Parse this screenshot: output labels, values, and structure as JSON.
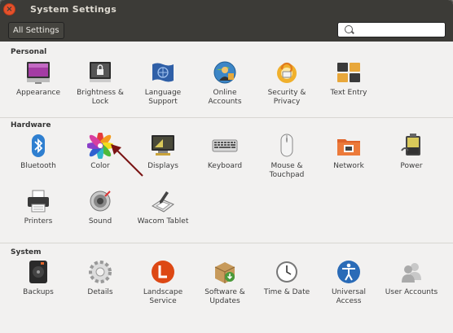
{
  "window": {
    "title": "System Settings"
  },
  "toolbar": {
    "all_settings_label": "All Settings",
    "search": {
      "value": "",
      "placeholder": ""
    }
  },
  "sections": {
    "personal": {
      "title": "Personal",
      "items": [
        {
          "label": "Appearance",
          "icon": "appearance-icon"
        },
        {
          "label": "Brightness &\nLock",
          "icon": "brightness-lock-icon"
        },
        {
          "label": "Language\nSupport",
          "icon": "language-support-icon"
        },
        {
          "label": "Online\nAccounts",
          "icon": "online-accounts-icon"
        },
        {
          "label": "Security &\nPrivacy",
          "icon": "security-privacy-icon"
        },
        {
          "label": "Text Entry",
          "icon": "text-entry-icon"
        }
      ]
    },
    "hardware": {
      "title": "Hardware",
      "items": [
        {
          "label": "Bluetooth",
          "icon": "bluetooth-icon"
        },
        {
          "label": "Color",
          "icon": "color-icon"
        },
        {
          "label": "Displays",
          "icon": "displays-icon"
        },
        {
          "label": "Keyboard",
          "icon": "keyboard-icon"
        },
        {
          "label": "Mouse &\nTouchpad",
          "icon": "mouse-touchpad-icon"
        },
        {
          "label": "Network",
          "icon": "network-icon"
        },
        {
          "label": "Power",
          "icon": "power-icon"
        },
        {
          "label": "Printers",
          "icon": "printers-icon"
        },
        {
          "label": "Sound",
          "icon": "sound-icon"
        },
        {
          "label": "Wacom Tablet",
          "icon": "wacom-tablet-icon"
        }
      ]
    },
    "system": {
      "title": "System",
      "items": [
        {
          "label": "Backups",
          "icon": "backups-icon"
        },
        {
          "label": "Details",
          "icon": "details-icon"
        },
        {
          "label": "Landscape\nService",
          "icon": "landscape-service-icon"
        },
        {
          "label": "Software &\nUpdates",
          "icon": "software-updates-icon"
        },
        {
          "label": "Time & Date",
          "icon": "time-date-icon"
        },
        {
          "label": "Universal\nAccess",
          "icon": "universal-access-icon"
        },
        {
          "label": "User Accounts",
          "icon": "user-accounts-icon"
        }
      ]
    }
  },
  "colors": {
    "titlebar": "#3c3b37",
    "close": "#e5512b",
    "background": "#f2f1f0",
    "annotation_arrow": "#7a1414"
  },
  "annotation": {
    "icon": "red-arrow-icon"
  }
}
